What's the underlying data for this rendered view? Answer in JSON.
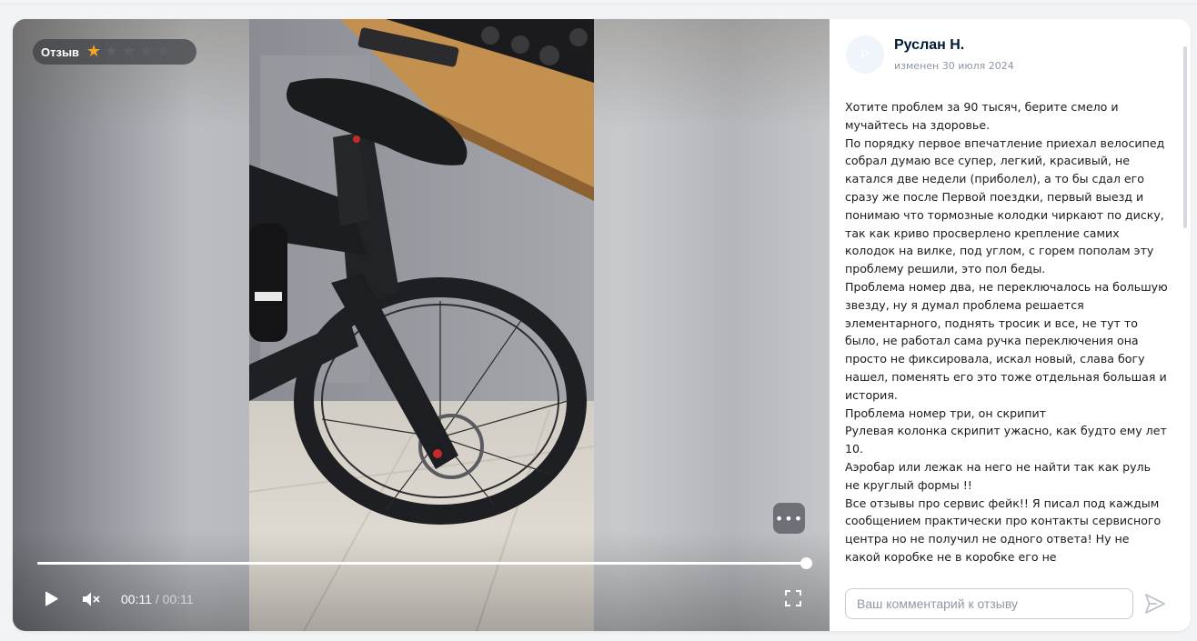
{
  "video": {
    "badge_label": "Отзыв",
    "rating": 1,
    "rating_max": 5,
    "progress": 1.0,
    "time_current": "00:11",
    "time_separator": " / ",
    "time_total": "00:11",
    "more_label": "•••"
  },
  "review": {
    "avatar_letter": "Р",
    "author": "Руслан Н.",
    "edited": "изменен 30 июля 2024",
    "text": "Хотите проблем за 90 тысяч, берите смело и мучайтесь на здоровье.\nПо порядку первое впечатление приехал велосипед собрал думаю все супер, легкий, красивый, не катался две недели (приболел), а то бы сдал его сразу же после Первой поездки, первый выезд и понимаю что тормозные колодки чиркают по диску, так как криво просверлено крепление самих колодок на вилке, под углом, с горем пополам эту проблему решили, это пол беды.\nПроблема номер два, не переключалось на большую звезду, ну я думал проблема решается элементарного, поднять тросик и все, не тут то было, не работал сама ручка переключения она просто не фиксировала, искал новый, слава богу нашел, поменять его это тоже отдельная большая и история.\nПроблема номер три, он скрипит\nРулевая колонка скрипит ужасно, как будто ему лет 10.\nАэробар или лежак на него не найти так как руль не круглый формы !!\nВсе отзывы про сервис фейк!! Я писал под каждым сообщением практически про контакты сервисного центра но не получил не одного ответа! Ну не какой коробке не в коробке его не"
  },
  "comment": {
    "placeholder": "Ваш комментарий к отзыву",
    "value": ""
  },
  "colors": {
    "star_on": "#f5a623",
    "star_off": "#5c5f66",
    "author": "#001a34",
    "muted": "#8d97a3"
  },
  "icons": [
    "star-icon",
    "play-icon",
    "mute-icon",
    "fullscreen-icon",
    "more-icon",
    "send-icon"
  ]
}
